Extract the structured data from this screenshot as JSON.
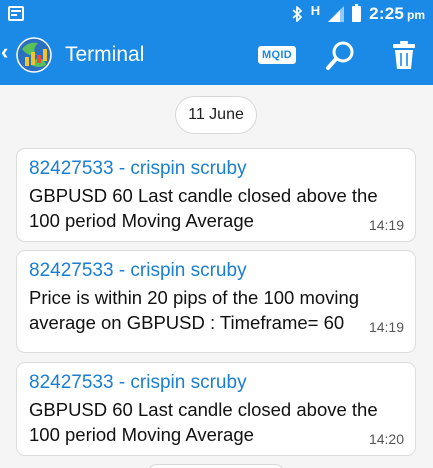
{
  "status_bar": {
    "network": "H",
    "time": "2:25",
    "ampm": "pm"
  },
  "action_bar": {
    "title": "Terminal",
    "mqid_label": "MQID"
  },
  "date_separator": "11 June",
  "messages": [
    {
      "sender": "82427533 - crispin scruby",
      "text": "GBPUSD 60 Last candle closed above the 100 period Moving Average",
      "time": "14:19"
    },
    {
      "sender": "82427533 - crispin scruby",
      "text": "Price is within 20 pips of the 100 moving average on GBPUSD : Timeframe= 60",
      "time": "14:19"
    },
    {
      "sender": "82427533 - crispin scruby",
      "text": "GBPUSD 60 Last candle closed above the 100 period Moving Average",
      "time": "14:20"
    }
  ],
  "colors": {
    "accent": "#1a8ae6",
    "sender": "#1a7fd4",
    "background": "#f5f5f5"
  },
  "icons": {
    "status": [
      "notification-icon",
      "bluetooth-icon",
      "signal-icon",
      "battery-icon"
    ],
    "toolbar": [
      "back-chevron-icon",
      "app-logo-icon",
      "search-icon",
      "trash-icon"
    ]
  }
}
